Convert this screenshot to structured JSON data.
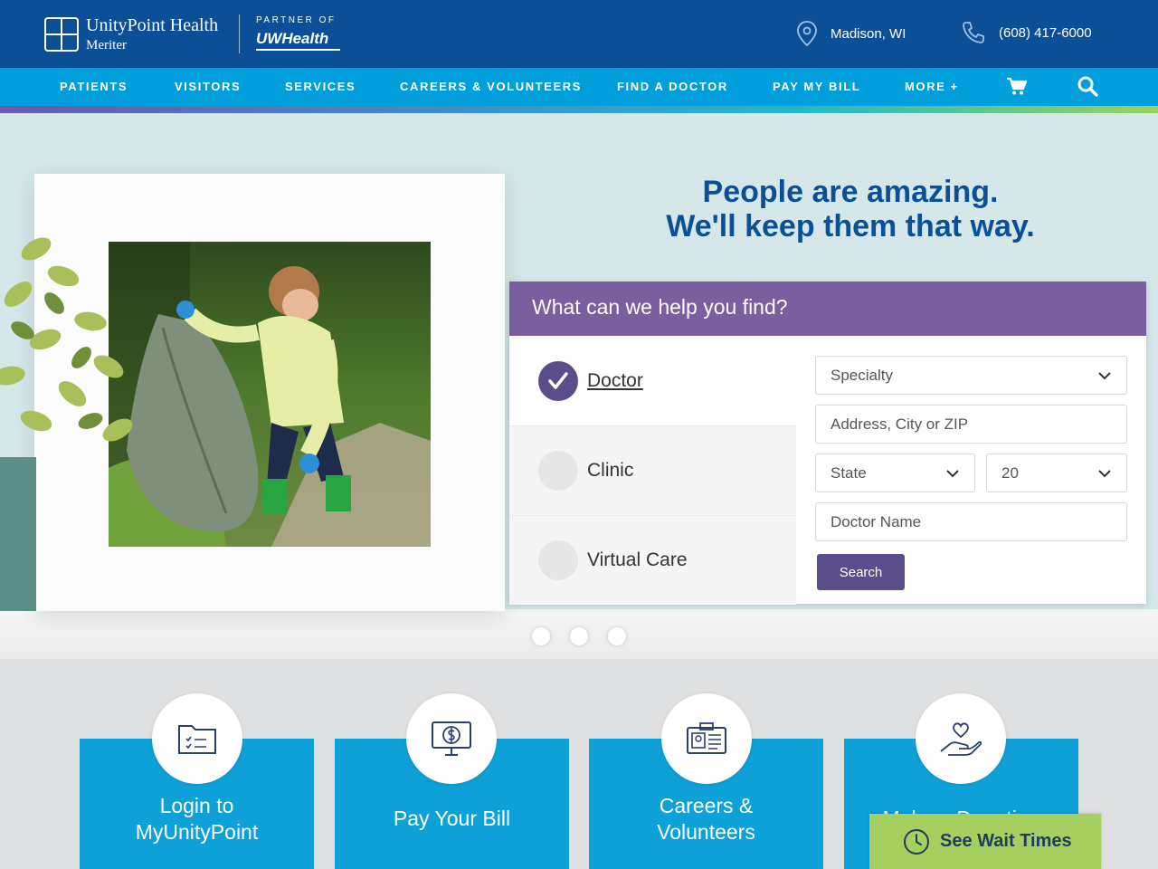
{
  "header": {
    "brand_name": "UnityPoint Health",
    "brand_sub": "Meriter",
    "partner_of": "PARTNER OF",
    "partner_brand": "UWHealth",
    "location": "Madison, WI",
    "phone": "(608) 417-6000"
  },
  "nav": {
    "items": [
      "PATIENTS",
      "VISITORS",
      "SERVICES",
      "CAREERS & VOLUNTEERS",
      "FIND A DOCTOR",
      "PAY MY BILL",
      "MORE +"
    ],
    "cart_icon": "cart-icon",
    "search_icon": "search-icon"
  },
  "hero": {
    "headline_line1": "People are amazing.",
    "headline_line2": "We'll keep them that way."
  },
  "finder": {
    "title": "What can we help you find?",
    "options": [
      {
        "label": "Doctor",
        "selected": true
      },
      {
        "label": "Clinic",
        "selected": false
      },
      {
        "label": "Virtual Care",
        "selected": false
      }
    ],
    "specialty_placeholder": "Specialty",
    "address_placeholder": "Address, City or ZIP",
    "state_placeholder": "State",
    "radius_value": "20",
    "doctor_name_placeholder": "Doctor Name",
    "search_label": "Search"
  },
  "cards": [
    {
      "label_line1": "Login to",
      "label_line2": "MyUnityPoint",
      "icon": "folder-checklist-icon"
    },
    {
      "label_line1": "Pay Your Bill",
      "label_line2": "",
      "icon": "monitor-dollar-icon"
    },
    {
      "label_line1": "Careers &",
      "label_line2": "Volunteers",
      "icon": "id-badge-icon"
    },
    {
      "label_line1": "Make a Donation",
      "label_line2": "",
      "icon": "heart-hand-icon"
    }
  ],
  "wait_times": {
    "label": "See Wait Times"
  },
  "colors": {
    "header_blue": "#0b4f96",
    "nav_blue": "#009fdb",
    "purple": "#7a5f9f",
    "button_purple": "#5b4d8a",
    "card_blue": "#0ea1d8",
    "wait_green": "#a5cf5e"
  }
}
